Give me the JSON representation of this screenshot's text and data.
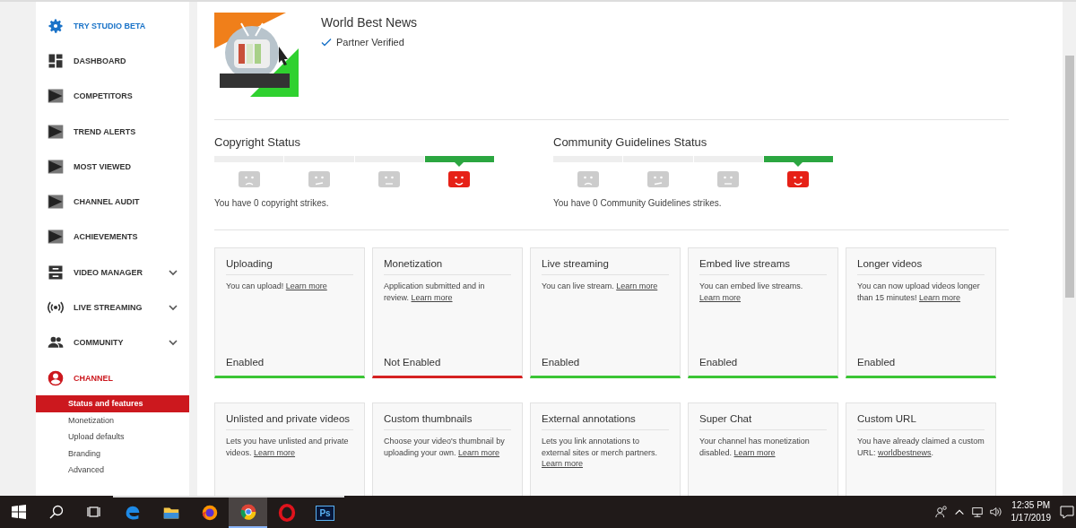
{
  "sidebar": {
    "items": [
      {
        "label": "TRY STUDIO BETA",
        "kind": "beta",
        "expandable": false,
        "selected": false
      },
      {
        "label": "DASHBOARD",
        "kind": "dashboard",
        "expandable": false,
        "selected": false
      },
      {
        "label": "COMPETITORS",
        "kind": "tool",
        "expandable": false,
        "selected": false
      },
      {
        "label": "TREND ALERTS",
        "kind": "tool",
        "expandable": false,
        "selected": false
      },
      {
        "label": "MOST VIEWED",
        "kind": "tool",
        "expandable": false,
        "selected": false
      },
      {
        "label": "CHANNEL AUDIT",
        "kind": "tool",
        "expandable": false,
        "selected": false
      },
      {
        "label": "ACHIEVEMENTS",
        "kind": "tool",
        "expandable": false,
        "selected": false
      },
      {
        "label": "VIDEO MANAGER",
        "kind": "videos",
        "expandable": true,
        "selected": false
      },
      {
        "label": "LIVE STREAMING",
        "kind": "live",
        "expandable": true,
        "selected": false
      },
      {
        "label": "COMMUNITY",
        "kind": "community",
        "expandable": true,
        "selected": false
      },
      {
        "label": "CHANNEL",
        "kind": "channel",
        "expandable": false,
        "selected": true,
        "children": [
          {
            "label": "Status and features",
            "selected": true
          },
          {
            "label": "Monetization",
            "selected": false
          },
          {
            "label": "Upload defaults",
            "selected": false
          },
          {
            "label": "Branding",
            "selected": false
          },
          {
            "label": "Advanced",
            "selected": false
          }
        ]
      }
    ]
  },
  "channel": {
    "name": "World Best News",
    "badge": "Partner Verified"
  },
  "statuses": [
    {
      "title": "Copyright Status",
      "segments": [
        {
          "selected": false
        },
        {
          "selected": false
        },
        {
          "selected": false
        },
        {
          "selected": true
        }
      ],
      "message": "You have 0 copyright strikes."
    },
    {
      "title": "Community Guidelines Status",
      "segments": [
        {
          "selected": false
        },
        {
          "selected": false
        },
        {
          "selected": false
        },
        {
          "selected": true
        }
      ],
      "message": "You have 0 Community Guidelines strikes."
    }
  ],
  "features": [
    {
      "title": "Uploading",
      "text": "You can upload!",
      "link": "Learn more",
      "status": "Enabled",
      "enabled": true
    },
    {
      "title": "Monetization",
      "text": "Application submitted and in review.",
      "link": "Learn more",
      "status": "Not Enabled",
      "enabled": false
    },
    {
      "title": "Live streaming",
      "text": "You can live stream.",
      "link": "Learn more",
      "status": "Enabled",
      "enabled": true
    },
    {
      "title": "Embed live streams",
      "text": "You can embed live streams.",
      "link": "Learn more",
      "status": "Enabled",
      "enabled": true
    },
    {
      "title": "Longer videos",
      "text": "You can now upload videos longer than 15 minutes!",
      "link": "Learn more",
      "status": "Enabled",
      "enabled": true
    },
    {
      "title": "Unlisted and private videos",
      "text": "Lets you have unlisted and private videos.",
      "link": "Learn more"
    },
    {
      "title": "Custom thumbnails",
      "text": "Choose your video's thumbnail by uploading your own.",
      "link": "Learn more"
    },
    {
      "title": "External annotations",
      "text": "Lets you link annotations to external sites or merch partners.",
      "link": "Learn more"
    },
    {
      "title": "Super Chat",
      "text": "Your channel has monetization disabled.",
      "link": "Learn more"
    },
    {
      "title": "Custom URL",
      "text": "You have already claimed a custom URL:",
      "link": "worldbestnews",
      "after": "."
    }
  ],
  "taskbar": {
    "apps": [
      {
        "kind": "edge",
        "selected": false
      },
      {
        "kind": "folder",
        "selected": false
      },
      {
        "kind": "firefox",
        "selected": false
      },
      {
        "kind": "chrome",
        "selected": true
      },
      {
        "kind": "opera",
        "selected": false
      },
      {
        "kind": "ps",
        "label": "Ps",
        "selected": false
      }
    ],
    "time": "12:35 PM",
    "date": "1/17/2019"
  }
}
